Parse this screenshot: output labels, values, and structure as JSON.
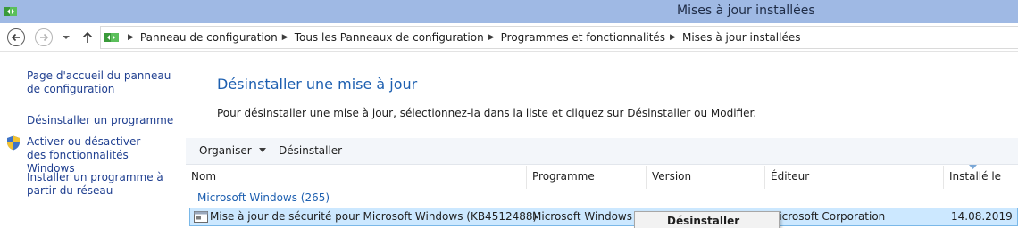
{
  "window": {
    "title": "Mises à jour installées"
  },
  "breadcrumb": {
    "items": [
      "Panneau de configuration",
      "Tous les Panneaux de configuration",
      "Programmes et fonctionnalités",
      "Mises à jour installées"
    ]
  },
  "sidebar": {
    "home_link": "Page d'accueil du panneau de configuration",
    "links": [
      "Désinstaller un programme",
      "Activer ou désactiver des fonctionnalités Windows",
      "Installer un programme à partir du réseau"
    ]
  },
  "content": {
    "title": "Désinstaller une mise à jour",
    "description": "Pour désinstaller une mise à jour, sélectionnez-la dans la liste et cliquez sur Désinstaller ou Modifier."
  },
  "toolbar": {
    "organise_label": "Organiser",
    "uninstall_label": "Désinstaller"
  },
  "table": {
    "columns": [
      "Nom",
      "Programme",
      "Version",
      "Éditeur",
      "Installé le"
    ],
    "group": "Microsoft Windows (265)",
    "rows": [
      {
        "name": "Mise à jour de sécurité pour Microsoft Windows (KB4512488)",
        "program": "Microsoft Windows",
        "version": "",
        "publisher": "licrosoft Corporation",
        "installed": "14.08.2019"
      }
    ]
  },
  "context_menu": {
    "items": [
      "Désinstaller"
    ]
  },
  "colors": {
    "titlebar": "#9fb9e4",
    "link": "#1f3f90",
    "heading": "#1d5fb0",
    "selection": "#cce8ff"
  }
}
